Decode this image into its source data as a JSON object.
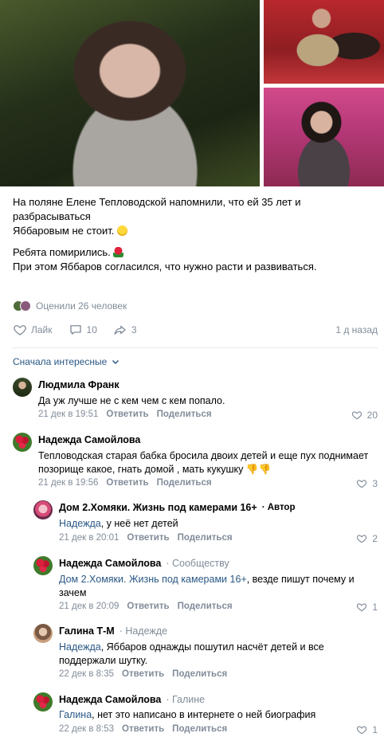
{
  "post": {
    "text_line1": "На поляне Елене Тепловодской напомнили, что ей 35 лет и разбрасываться",
    "text_line2": "Яббаровым не стоит.",
    "text_line3": "Ребята помирились.",
    "text_line4": "При этом Яббаров согласился, что нужно расти и развиваться."
  },
  "liked_by": "Оценили 26 человек",
  "actions": {
    "like_label": "Лайк",
    "comments_count": "10",
    "shares_count": "3",
    "time_ago": "1 д назад"
  },
  "sort_label": "Сначала интересные",
  "comments": [
    {
      "name": "Людмила Франк",
      "text": "Да уж лучше не с кем чем с кем попало.",
      "date": "21 дек в 19:51",
      "reply": "Ответить",
      "share": "Поделиться",
      "likes": "20"
    },
    {
      "name": "Надежда Самойлова",
      "text_line1": "Тепловодская старая бабка бросила двоих детей и еще пух поднимает",
      "text_line2": "позорище какое, гнать домой , мать кукушку",
      "date": "21 дек в 19:56",
      "reply": "Ответить",
      "share": "Поделиться",
      "likes": "3"
    },
    {
      "name": "Дом 2.Хомяки. Жизнь под камерами 16+",
      "badge": "Автор",
      "mention": "Надежда",
      "text": ", у неё нет детей",
      "date": "21 дек в 20:01",
      "reply": "Ответить",
      "share": "Поделиться",
      "likes": "2"
    },
    {
      "name": "Надежда Самойлова",
      "reply_to": "Сообществу",
      "mention": "Дом 2.Хомяки. Жизнь под камерами 16+",
      "text_line1": ", везде пишут почему и",
      "text_line2": "зачем",
      "date": "21 дек в 20:09",
      "reply": "Ответить",
      "share": "Поделиться",
      "likes": "1"
    },
    {
      "name": "Галина Т-М",
      "reply_to": "Надежде",
      "mention": "Надежда",
      "text_line1": ", Яббаров однажды пошутил насчёт детей и все",
      "text_line2": "поддержали шутку.",
      "date": "22 дек в 8:35",
      "reply": "Ответить",
      "share": "Поделиться"
    },
    {
      "name": "Надежда Самойлова",
      "reply_to": "Галине",
      "mention": "Галина",
      "text": ", нет это написано в интернете о ней биография",
      "date": "22 дек в 8:53",
      "reply": "Ответить",
      "share": "Поделиться",
      "likes": "1"
    }
  ],
  "colors": {
    "link": "#2a5885",
    "muted": "#818c99",
    "divider": "#e7e8ec"
  },
  "icons": [
    "heart-icon",
    "comment-icon",
    "share-icon",
    "chevron-down-icon",
    "thumbs-down-emoji",
    "rose-emoji",
    "grin-emoji"
  ]
}
